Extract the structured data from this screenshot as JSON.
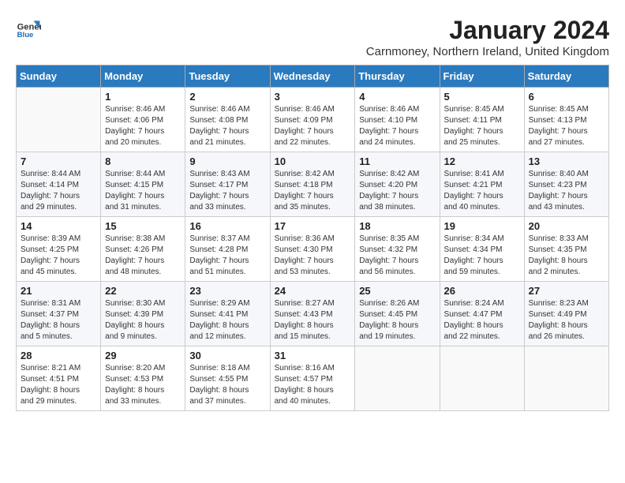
{
  "header": {
    "logo_line1": "General",
    "logo_line2": "Blue",
    "title": "January 2024",
    "subtitle": "Carnmoney, Northern Ireland, United Kingdom"
  },
  "days_of_week": [
    "Sunday",
    "Monday",
    "Tuesday",
    "Wednesday",
    "Thursday",
    "Friday",
    "Saturday"
  ],
  "weeks": [
    [
      {
        "day": "",
        "info": ""
      },
      {
        "day": "1",
        "info": "Sunrise: 8:46 AM\nSunset: 4:06 PM\nDaylight: 7 hours\nand 20 minutes."
      },
      {
        "day": "2",
        "info": "Sunrise: 8:46 AM\nSunset: 4:08 PM\nDaylight: 7 hours\nand 21 minutes."
      },
      {
        "day": "3",
        "info": "Sunrise: 8:46 AM\nSunset: 4:09 PM\nDaylight: 7 hours\nand 22 minutes."
      },
      {
        "day": "4",
        "info": "Sunrise: 8:46 AM\nSunset: 4:10 PM\nDaylight: 7 hours\nand 24 minutes."
      },
      {
        "day": "5",
        "info": "Sunrise: 8:45 AM\nSunset: 4:11 PM\nDaylight: 7 hours\nand 25 minutes."
      },
      {
        "day": "6",
        "info": "Sunrise: 8:45 AM\nSunset: 4:13 PM\nDaylight: 7 hours\nand 27 minutes."
      }
    ],
    [
      {
        "day": "7",
        "info": "Sunrise: 8:44 AM\nSunset: 4:14 PM\nDaylight: 7 hours\nand 29 minutes."
      },
      {
        "day": "8",
        "info": "Sunrise: 8:44 AM\nSunset: 4:15 PM\nDaylight: 7 hours\nand 31 minutes."
      },
      {
        "day": "9",
        "info": "Sunrise: 8:43 AM\nSunset: 4:17 PM\nDaylight: 7 hours\nand 33 minutes."
      },
      {
        "day": "10",
        "info": "Sunrise: 8:42 AM\nSunset: 4:18 PM\nDaylight: 7 hours\nand 35 minutes."
      },
      {
        "day": "11",
        "info": "Sunrise: 8:42 AM\nSunset: 4:20 PM\nDaylight: 7 hours\nand 38 minutes."
      },
      {
        "day": "12",
        "info": "Sunrise: 8:41 AM\nSunset: 4:21 PM\nDaylight: 7 hours\nand 40 minutes."
      },
      {
        "day": "13",
        "info": "Sunrise: 8:40 AM\nSunset: 4:23 PM\nDaylight: 7 hours\nand 43 minutes."
      }
    ],
    [
      {
        "day": "14",
        "info": "Sunrise: 8:39 AM\nSunset: 4:25 PM\nDaylight: 7 hours\nand 45 minutes."
      },
      {
        "day": "15",
        "info": "Sunrise: 8:38 AM\nSunset: 4:26 PM\nDaylight: 7 hours\nand 48 minutes."
      },
      {
        "day": "16",
        "info": "Sunrise: 8:37 AM\nSunset: 4:28 PM\nDaylight: 7 hours\nand 51 minutes."
      },
      {
        "day": "17",
        "info": "Sunrise: 8:36 AM\nSunset: 4:30 PM\nDaylight: 7 hours\nand 53 minutes."
      },
      {
        "day": "18",
        "info": "Sunrise: 8:35 AM\nSunset: 4:32 PM\nDaylight: 7 hours\nand 56 minutes."
      },
      {
        "day": "19",
        "info": "Sunrise: 8:34 AM\nSunset: 4:34 PM\nDaylight: 7 hours\nand 59 minutes."
      },
      {
        "day": "20",
        "info": "Sunrise: 8:33 AM\nSunset: 4:35 PM\nDaylight: 8 hours\nand 2 minutes."
      }
    ],
    [
      {
        "day": "21",
        "info": "Sunrise: 8:31 AM\nSunset: 4:37 PM\nDaylight: 8 hours\nand 5 minutes."
      },
      {
        "day": "22",
        "info": "Sunrise: 8:30 AM\nSunset: 4:39 PM\nDaylight: 8 hours\nand 9 minutes."
      },
      {
        "day": "23",
        "info": "Sunrise: 8:29 AM\nSunset: 4:41 PM\nDaylight: 8 hours\nand 12 minutes."
      },
      {
        "day": "24",
        "info": "Sunrise: 8:27 AM\nSunset: 4:43 PM\nDaylight: 8 hours\nand 15 minutes."
      },
      {
        "day": "25",
        "info": "Sunrise: 8:26 AM\nSunset: 4:45 PM\nDaylight: 8 hours\nand 19 minutes."
      },
      {
        "day": "26",
        "info": "Sunrise: 8:24 AM\nSunset: 4:47 PM\nDaylight: 8 hours\nand 22 minutes."
      },
      {
        "day": "27",
        "info": "Sunrise: 8:23 AM\nSunset: 4:49 PM\nDaylight: 8 hours\nand 26 minutes."
      }
    ],
    [
      {
        "day": "28",
        "info": "Sunrise: 8:21 AM\nSunset: 4:51 PM\nDaylight: 8 hours\nand 29 minutes."
      },
      {
        "day": "29",
        "info": "Sunrise: 8:20 AM\nSunset: 4:53 PM\nDaylight: 8 hours\nand 33 minutes."
      },
      {
        "day": "30",
        "info": "Sunrise: 8:18 AM\nSunset: 4:55 PM\nDaylight: 8 hours\nand 37 minutes."
      },
      {
        "day": "31",
        "info": "Sunrise: 8:16 AM\nSunset: 4:57 PM\nDaylight: 8 hours\nand 40 minutes."
      },
      {
        "day": "",
        "info": ""
      },
      {
        "day": "",
        "info": ""
      },
      {
        "day": "",
        "info": ""
      }
    ]
  ]
}
